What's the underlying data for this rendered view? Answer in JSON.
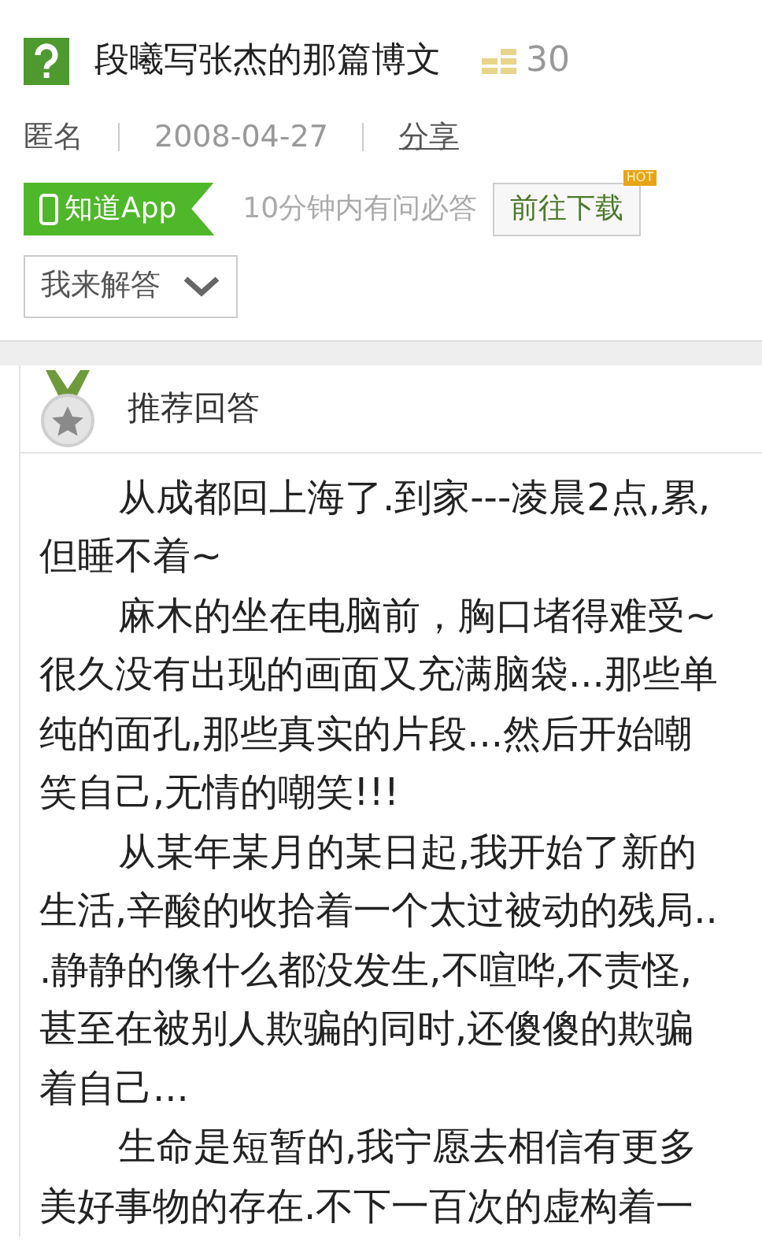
{
  "question": {
    "title": "段曦写张杰的那篇博文",
    "reward": "30"
  },
  "meta": {
    "author": "匿名",
    "date": "2008-04-27",
    "share": "分享"
  },
  "app_banner": {
    "badge": "知道App",
    "slogan": "10分钟内有问必答",
    "download": "前往下载",
    "hot": "HOT"
  },
  "answer_button": "我来解答",
  "answer": {
    "heading": "推荐回答",
    "paragraphs": [
      {
        "lines": [
          "从成都回上海了.到家---凌晨2点,累,",
          "但睡不着~"
        ]
      },
      {
        "lines": [
          "麻木的坐在电脑前，胸口堵得难受~",
          "很久没有出现的画面又充满脑袋...那些单",
          "纯的面孔,那些真实的片段...然后开始嘲",
          "笑自己,无情的嘲笑!!!"
        ]
      },
      {
        "lines": [
          "从某年某月的某日起,我开始了新的",
          "生活,辛酸的收拾着一个太过被动的残局..",
          ".静静的像什么都没发生,不喧哗,不责怪,",
          "甚至在被别人欺骗的同时,还傻傻的欺骗",
          "着自己..."
        ]
      },
      {
        "lines": [
          "生命是短暂的,我宁愿去相信有更多",
          "美好事物的存在.不下一百次的虚构着一"
        ]
      }
    ]
  }
}
